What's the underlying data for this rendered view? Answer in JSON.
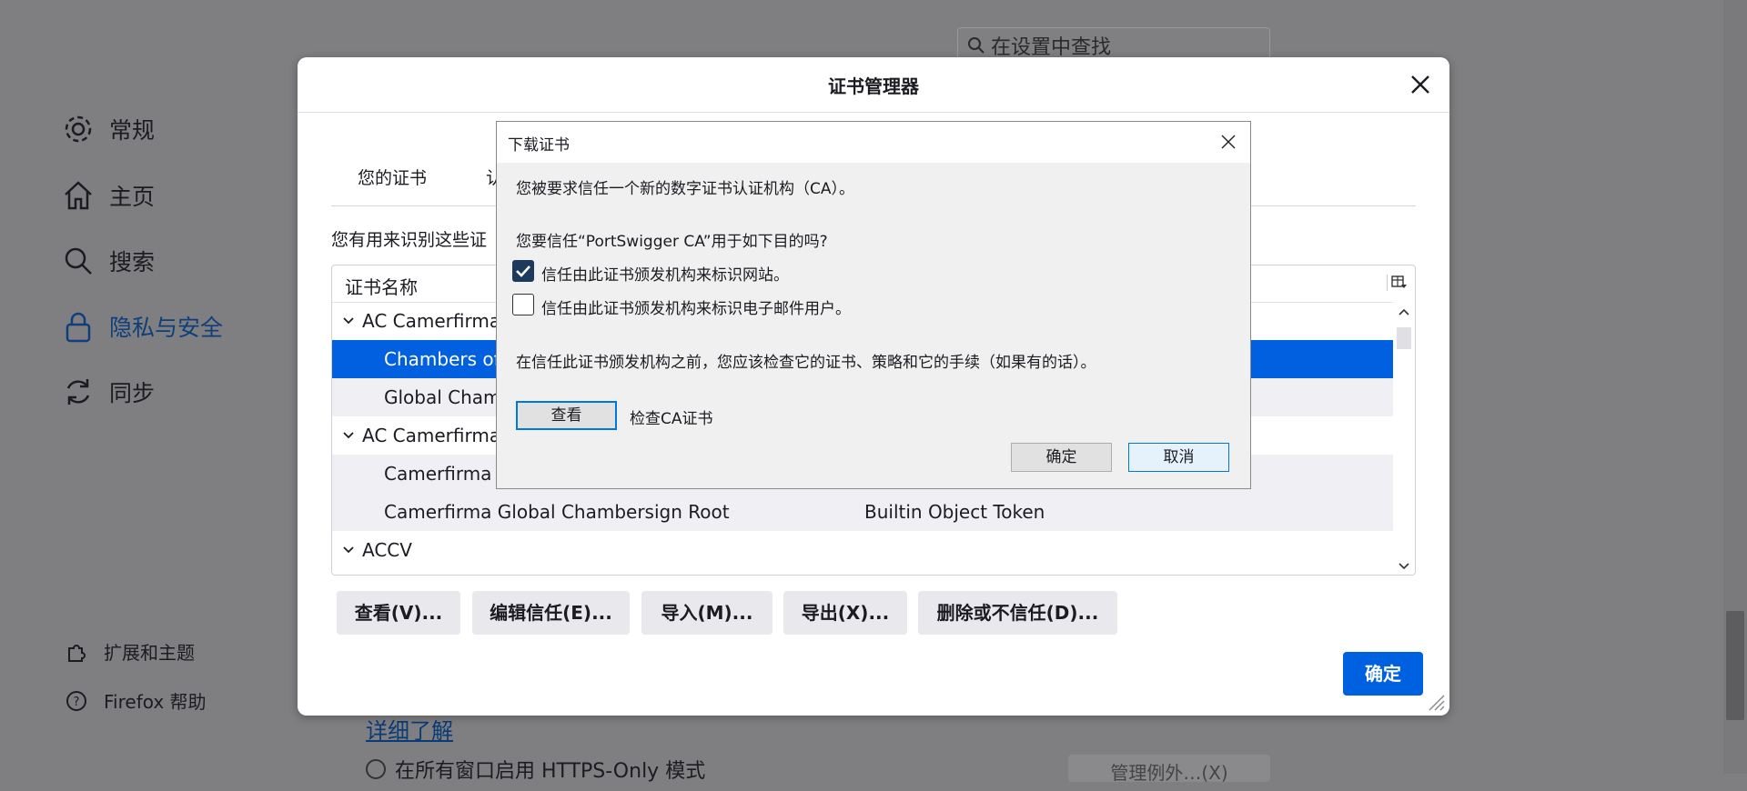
{
  "settings": {
    "search_placeholder": "在设置中查找",
    "nav": [
      {
        "label": "常规",
        "icon": "gear-icon"
      },
      {
        "label": "主页",
        "icon": "home-icon"
      },
      {
        "label": "搜索",
        "icon": "search-icon"
      },
      {
        "label": "隐私与安全",
        "icon": "lock-icon"
      },
      {
        "label": "同步",
        "icon": "sync-icon"
      }
    ],
    "footer_nav": [
      {
        "label": "扩展和主题",
        "icon": "puzzle-icon"
      },
      {
        "label": "Firefox 帮助",
        "icon": "help-icon"
      }
    ],
    "learn_more": "详细了解",
    "https_only_label": "在所有窗口启用 HTTPS-Only 模式",
    "manage_exceptions": "管理例外…(X)"
  },
  "cert_manager": {
    "title": "证书管理器",
    "tabs": [
      "您的证书",
      "认"
    ],
    "description": "您有用来识别这些证",
    "column_name": "证书名称",
    "rows": [
      {
        "name": "AC Camerfirma",
        "token": "",
        "type": "group"
      },
      {
        "name": "Chambers of",
        "token": "",
        "type": "selected"
      },
      {
        "name": "Global Cham",
        "token": "",
        "type": "item"
      },
      {
        "name": "AC Camerfirma",
        "token": "",
        "type": "group"
      },
      {
        "name": "Camerfirma C",
        "token": "",
        "type": "item"
      },
      {
        "name": "Camerfirma Global Chambersign Root",
        "token": "Builtin Object Token",
        "type": "item"
      },
      {
        "name": "ACCV",
        "token": "",
        "type": "group"
      }
    ],
    "buttons": {
      "view": "查看(V)...",
      "edit_trust": "编辑信任(E)...",
      "import": "导入(M)...",
      "export": "导出(X)...",
      "delete": "删除或不信任(D)..."
    },
    "ok": "确定"
  },
  "download_dialog": {
    "title": "下载证书",
    "line1": "您被要求信任一个新的数字证书认证机构（CA）。",
    "question": "您要信任“PortSwigger CA”用于如下目的吗?",
    "check_websites": "信任由此证书颁发机构来标识网站。",
    "check_websites_checked": true,
    "check_email": "信任由此证书颁发机构来标识电子邮件用户。",
    "check_email_checked": false,
    "advice": "在信任此证书颁发机构之前，您应该检查它的证书、策略和它的手续（如果有的话）。",
    "view_button": "查看",
    "view_hint": "检查CA证书",
    "ok": "确定",
    "cancel": "取消"
  }
}
